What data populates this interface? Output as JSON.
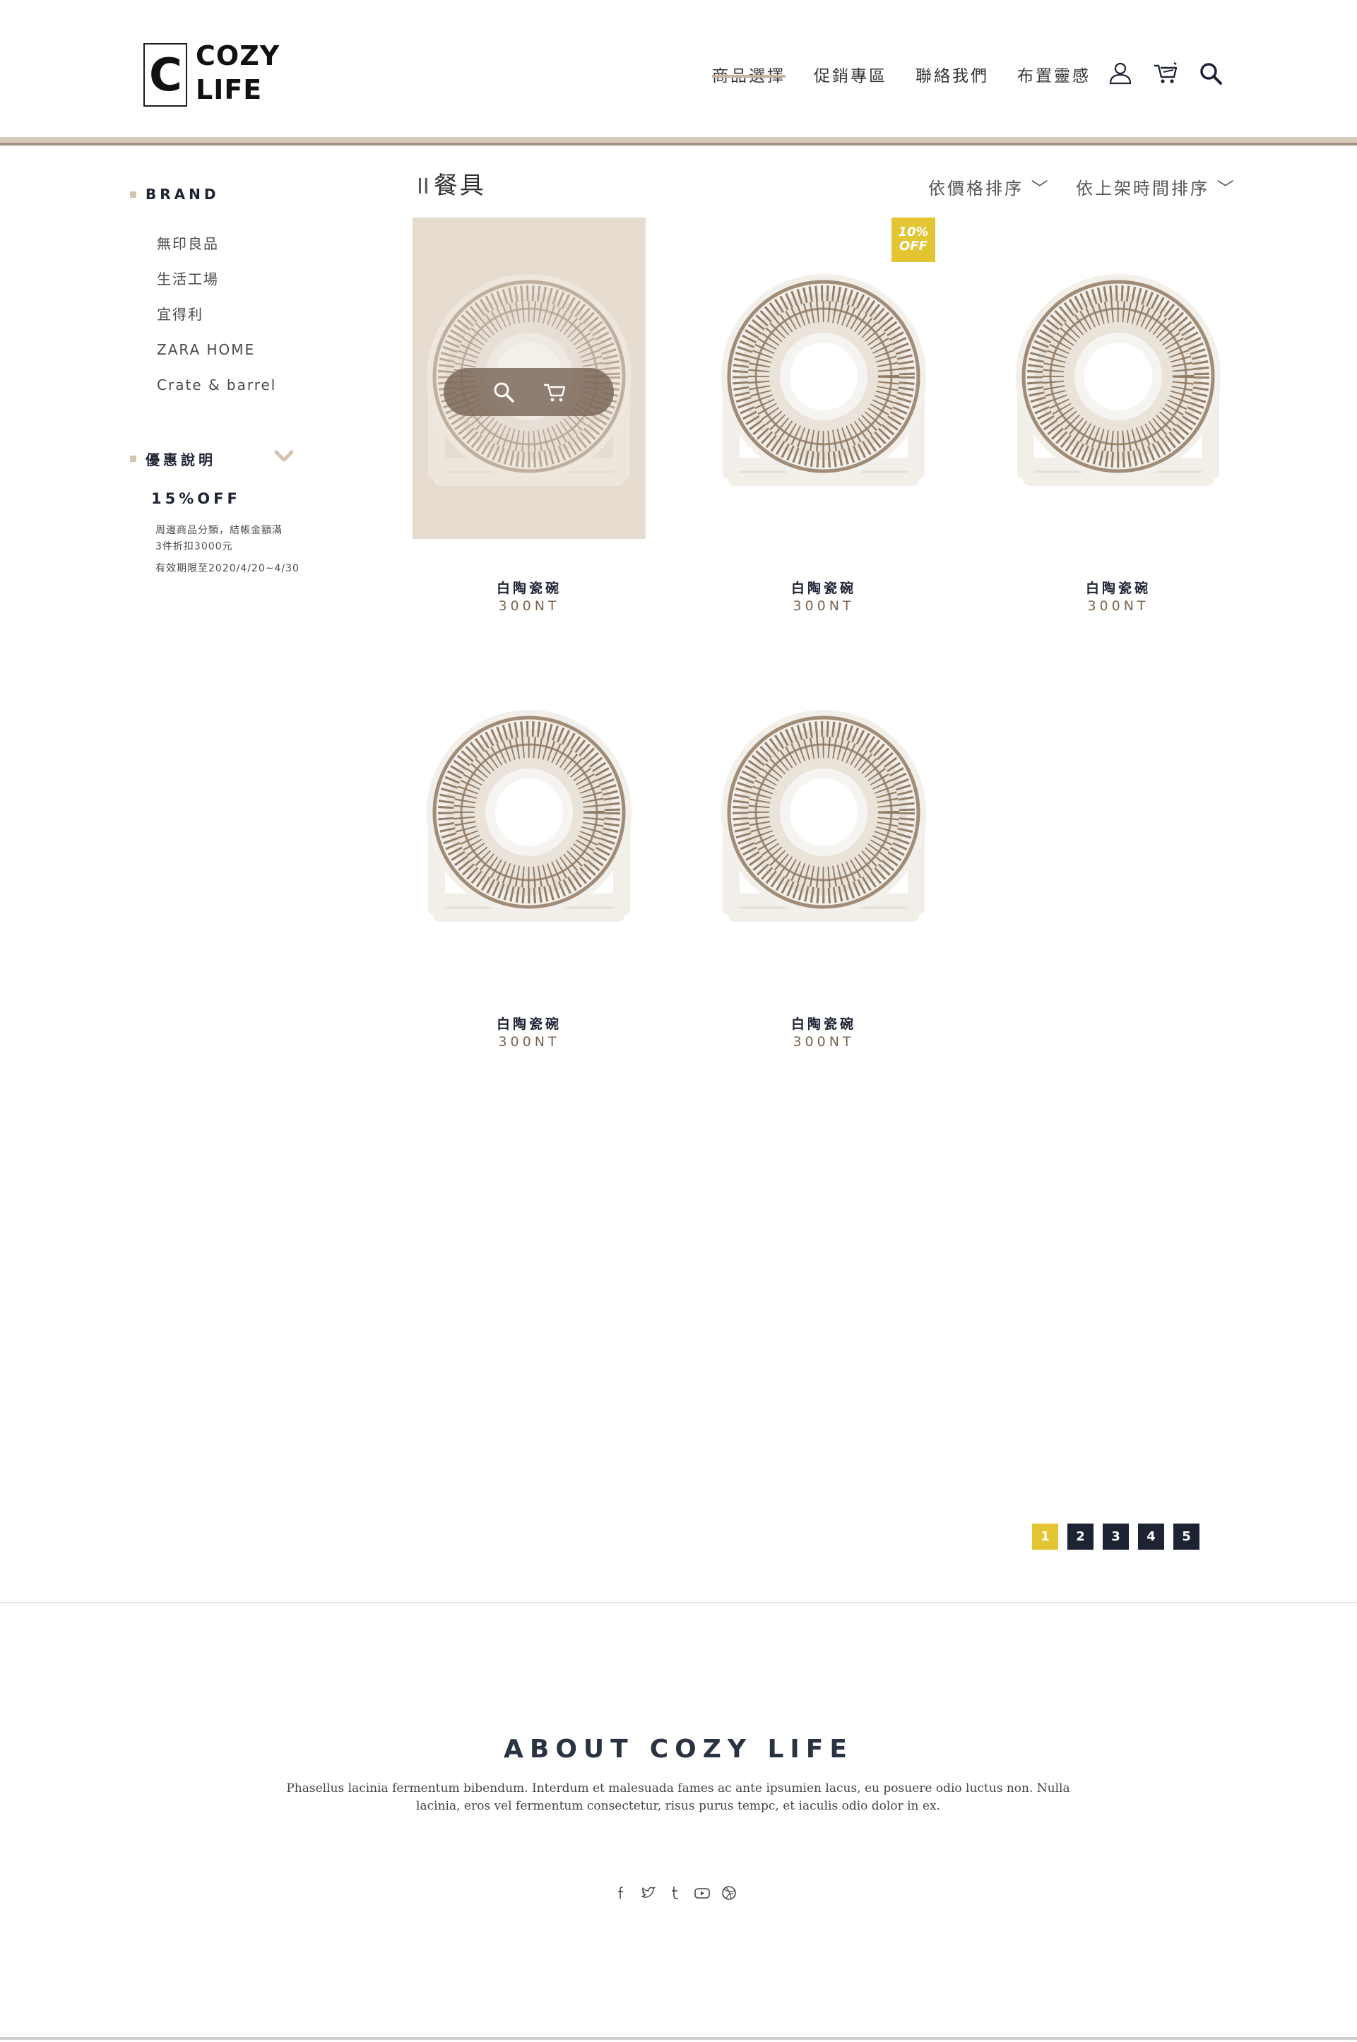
{
  "brand": {
    "logo_letter": "C",
    "logo_line1": "COZY",
    "logo_line2": "LIFE"
  },
  "nav": {
    "items": [
      {
        "label": "商品選擇",
        "active": true
      },
      {
        "label": "促銷專區"
      },
      {
        "label": "聯絡我們"
      },
      {
        "label": "布置靈感"
      }
    ],
    "icons": [
      "user-icon",
      "cart-icon",
      "search-icon"
    ]
  },
  "sidebar": {
    "brand_title": "BRAND",
    "brands": [
      "無印良品",
      "生活工場",
      "宜得利",
      "ZARA HOME",
      "Crate & barrel"
    ],
    "promo_title": "優惠說明",
    "promo_off": "15%OFF",
    "promo_note_1": "周邊商品分類，結帳金額滿",
    "promo_note_2": "3件折扣3000元",
    "promo_period": "有效期限至2020/4/20~4/30"
  },
  "content": {
    "title_bars": "II",
    "title": "餐具",
    "sort_price": "依價格排序 ﹀",
    "sort_date": "依上架時間排序 ﹀",
    "badge_line1": "10%",
    "badge_line2": "OFF",
    "products": [
      {
        "name": "白陶瓷碗",
        "price": "300NT"
      },
      {
        "name": "白陶瓷碗",
        "price": "300NT"
      },
      {
        "name": "白陶瓷碗",
        "price": "300NT"
      },
      {
        "name": "白陶瓷碗",
        "price": "300NT"
      },
      {
        "name": "白陶瓷碗",
        "price": "300NT"
      }
    ]
  },
  "pagination": {
    "pages": [
      "1",
      "2",
      "3",
      "4",
      "5"
    ],
    "current": "1"
  },
  "footer": {
    "about_prefix": "ABOUT",
    "about_brand": "COZY LIFE",
    "about_text": "Phasellus lacinia fermentum bibendum. Interdum et malesuada fames ac ante ipsumien lacus, eu posuere odio luctus non. Nulla lacinia, eros vel fermentum consectetur, risus purus tempc, et iaculis odio dolor in ex.",
    "social": [
      "facebook-icon",
      "twitter-icon",
      "tumblr-icon",
      "youtube-icon",
      "dribbble-icon"
    ]
  },
  "colors": {
    "accent_yellow": "#e3c534",
    "navy": "#1d2333",
    "beige": "#d9cbbb",
    "hover_bg": "#e6dccf",
    "price_brown": "#7a6550"
  }
}
